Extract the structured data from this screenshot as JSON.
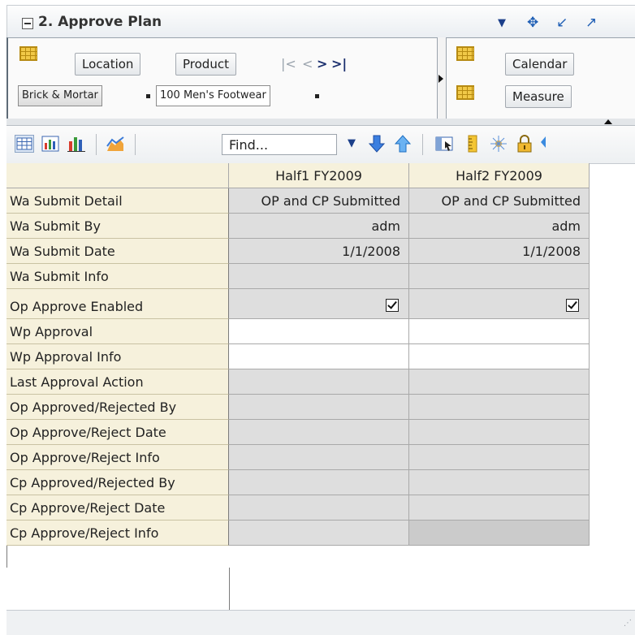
{
  "window": {
    "title": "2. Approve Plan",
    "controls": [
      "dropdown-arrow-icon",
      "move-icon",
      "minimize-icon",
      "maximize-icon"
    ]
  },
  "pivot": {
    "row_dims": [
      "Location",
      "Product"
    ],
    "row_selections": [
      "Brick & Mortar",
      "100 Men's Footwear"
    ],
    "col_dims": [
      "Calendar",
      "Measure"
    ]
  },
  "toolbar": {
    "find_placeholder": "Find..."
  },
  "table": {
    "columns": [
      "Half1 FY2009",
      "Half2 FY2009"
    ],
    "rows": [
      {
        "label": "Wa Submit Detail",
        "values": [
          "OP and CP Submitted",
          "OP and CP Submitted"
        ]
      },
      {
        "label": "Wa Submit By",
        "values": [
          "adm",
          "adm"
        ]
      },
      {
        "label": "Wa Submit Date",
        "values": [
          "1/1/2008",
          "1/1/2008"
        ]
      },
      {
        "label": "Wa Submit Info",
        "values": [
          "",
          ""
        ]
      },
      {
        "label": "Op Approve Enabled",
        "values": [
          "checked",
          "checked"
        ]
      },
      {
        "label": "Wp Approval",
        "values": [
          "",
          ""
        ]
      },
      {
        "label": "Wp Approval Info",
        "values": [
          "",
          ""
        ]
      },
      {
        "label": "Last Approval Action",
        "values": [
          "",
          ""
        ]
      },
      {
        "label": "Op Approved/Rejected By",
        "values": [
          "",
          ""
        ]
      },
      {
        "label": "Op Approve/Reject Date",
        "values": [
          "",
          ""
        ]
      },
      {
        "label": "Op Approve/Reject Info",
        "values": [
          "",
          ""
        ]
      },
      {
        "label": "Cp Approved/Rejected By",
        "values": [
          "",
          ""
        ]
      },
      {
        "label": "Cp Approve/Reject Date",
        "values": [
          "",
          ""
        ]
      },
      {
        "label": "Cp Approve/Reject Info",
        "values": [
          "",
          ""
        ]
      }
    ]
  },
  "colors": {
    "label_bg": "#f6f1dc",
    "readonly_cell": "#dedede",
    "editable_cell": "#ffffff",
    "accent_blue": "#1f5fb5"
  }
}
